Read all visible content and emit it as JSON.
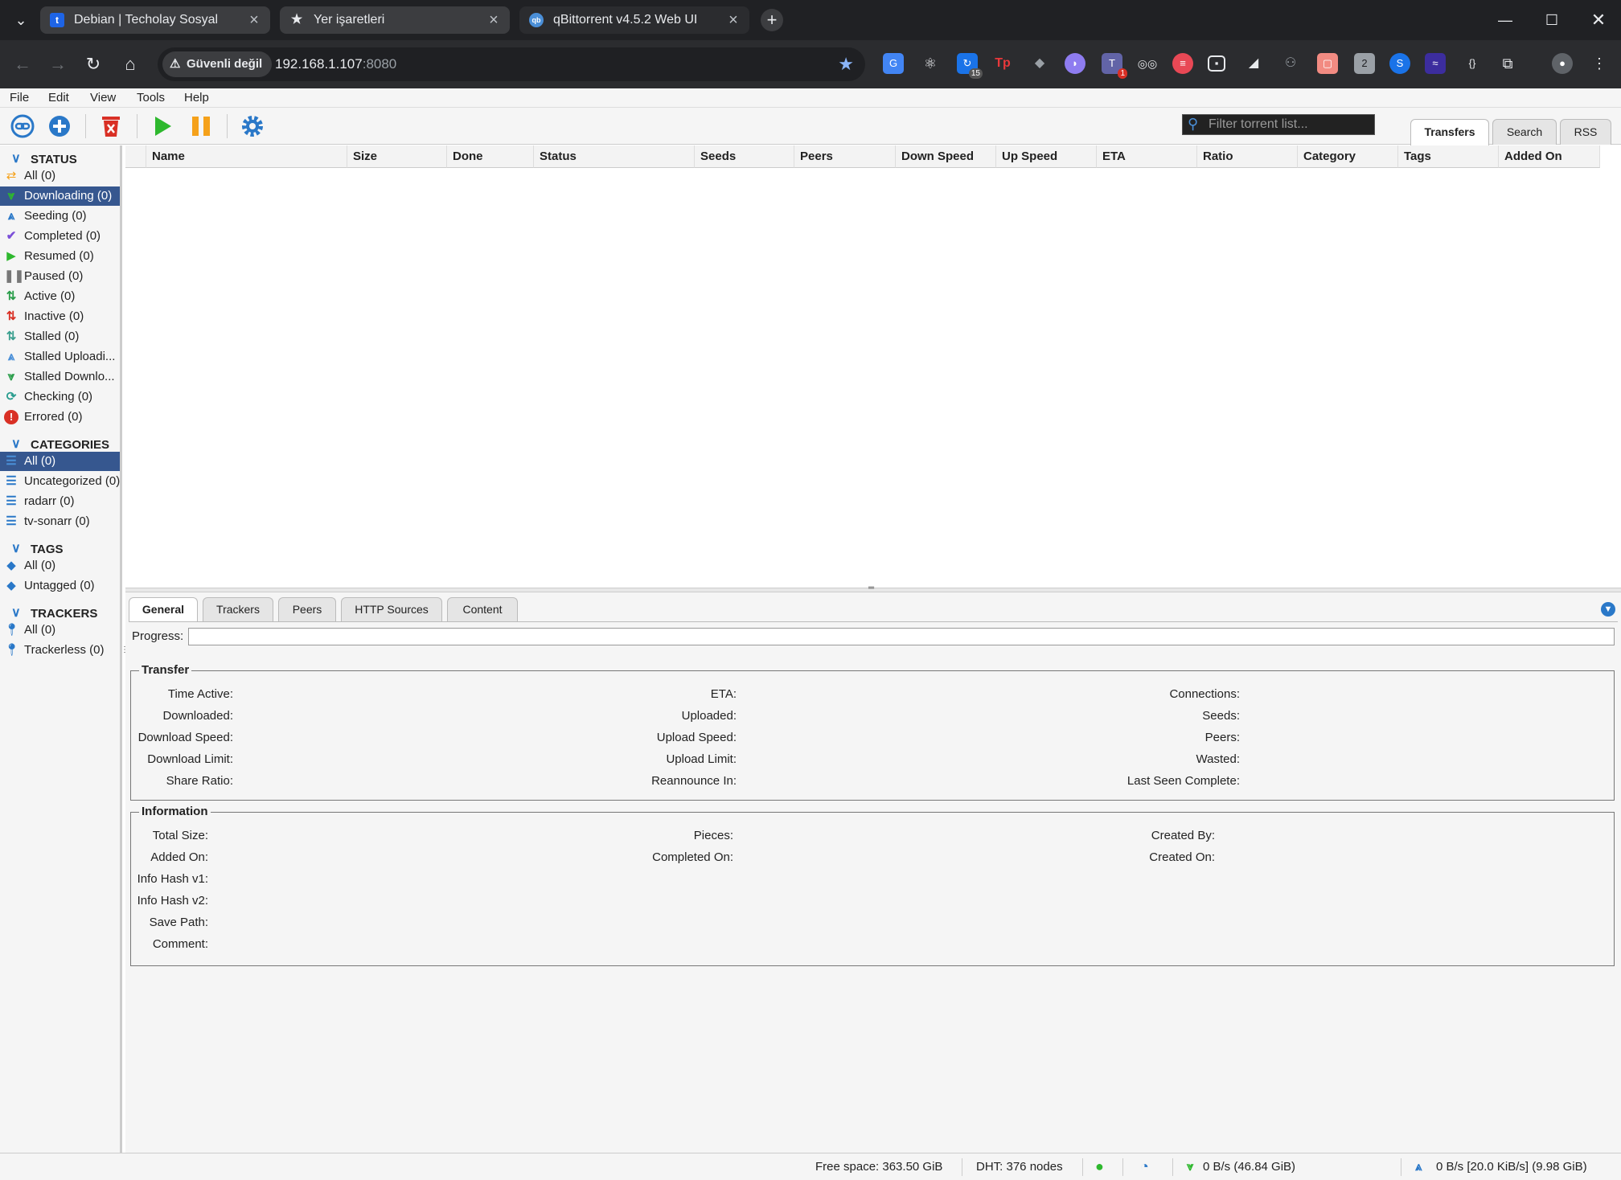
{
  "browser": {
    "tabs": [
      {
        "title": "Debian | Techolay Sosyal",
        "favicon": "t"
      },
      {
        "title": "Yer işaretleri",
        "favicon": "star"
      },
      {
        "title": "qBittorrent v4.5.2 Web UI",
        "favicon": "qb"
      }
    ],
    "security_chip": "Güvenli değil",
    "url_host": "192.168.1.107",
    "url_port": ":8080",
    "extension_badges": {
      "ext3": "15",
      "ext7": "1"
    }
  },
  "menu": [
    "File",
    "Edit",
    "View",
    "Tools",
    "Help"
  ],
  "toolbar": {
    "filter_placeholder": "Filter torrent list...",
    "right_tabs": [
      "Transfers",
      "Search",
      "RSS"
    ]
  },
  "sidebar": {
    "status": {
      "heading": "STATUS",
      "items": [
        "All (0)",
        "Downloading (0)",
        "Seeding (0)",
        "Completed (0)",
        "Resumed (0)",
        "Paused (0)",
        "Active (0)",
        "Inactive (0)",
        "Stalled (0)",
        "Stalled Uploadi...",
        "Stalled Downlo...",
        "Checking (0)",
        "Errored (0)"
      ]
    },
    "categories": {
      "heading": "CATEGORIES",
      "items": [
        "All (0)",
        "Uncategorized (0)",
        "radarr (0)",
        "tv-sonarr (0)"
      ]
    },
    "tags": {
      "heading": "TAGS",
      "items": [
        "All (0)",
        "Untagged (0)"
      ]
    },
    "trackers": {
      "heading": "TRACKERS",
      "items": [
        "All (0)",
        "Trackerless (0)"
      ]
    }
  },
  "table": {
    "columns": [
      "Name",
      "Size",
      "Done",
      "Status",
      "Seeds",
      "Peers",
      "Down Speed",
      "Up Speed",
      "ETA",
      "Ratio",
      "Category",
      "Tags",
      "Added On"
    ]
  },
  "properties": {
    "tabs": [
      "General",
      "Trackers",
      "Peers",
      "HTTP Sources",
      "Content"
    ],
    "progress_label": "Progress:",
    "progress_value": 0,
    "transfer": {
      "legend": "Transfer",
      "col1": [
        "Time Active:",
        "Downloaded:",
        "Download Speed:",
        "Download Limit:",
        "Share Ratio:"
      ],
      "col2": [
        "ETA:",
        "Uploaded:",
        "Upload Speed:",
        "Upload Limit:",
        "Reannounce In:"
      ],
      "col3": [
        "Connections:",
        "Seeds:",
        "Peers:",
        "Wasted:",
        "Last Seen Complete:"
      ]
    },
    "information": {
      "legend": "Information",
      "col1": [
        "Total Size:",
        "Added On:",
        "Info Hash v1:",
        "Info Hash v2:",
        "Save Path:",
        "Comment:"
      ],
      "col2": [
        "Pieces:",
        "Completed On:"
      ],
      "col3": [
        "Created By:",
        "Created On:"
      ]
    }
  },
  "statusbar": {
    "free_space": "Free space: 363.50 GiB",
    "dht": "DHT: 376 nodes",
    "download": "0 B/s (46.84 GiB)",
    "upload": "0 B/s [20.0 KiB/s] (9.98 GiB)"
  },
  "colors": {
    "accent": "#2a78c8",
    "selection": "#36578f",
    "browser_bg": "#202124"
  }
}
